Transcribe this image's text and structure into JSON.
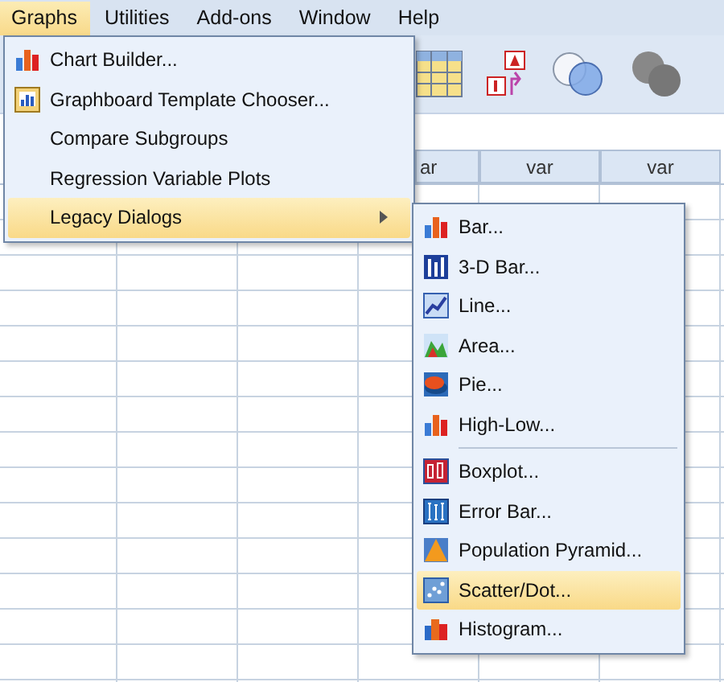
{
  "menubar": [
    {
      "label": "Graphs",
      "selected": true
    },
    {
      "label": "Utilities",
      "selected": false
    },
    {
      "label": "Add-ons",
      "selected": false
    },
    {
      "label": "Window",
      "selected": false
    },
    {
      "label": "Help",
      "selected": false
    }
  ],
  "grid": {
    "columns": [
      "ar",
      "var",
      "var"
    ]
  },
  "graphs_menu": [
    {
      "label": "Chart Builder...",
      "kind": "chart-builder",
      "selected": false,
      "submenu": false
    },
    {
      "label": "Graphboard Template Chooser...",
      "kind": "graphboard",
      "selected": false,
      "submenu": false
    },
    {
      "label": "Compare Subgroups",
      "kind": "plain",
      "selected": false,
      "submenu": false
    },
    {
      "label": "Regression Variable Plots",
      "kind": "plain",
      "selected": false,
      "submenu": false
    },
    {
      "label": "Legacy Dialogs",
      "kind": "plain",
      "selected": true,
      "submenu": true
    }
  ],
  "legacy_dialogs_menu": [
    {
      "label": "Bar...",
      "kind": "bar",
      "selected": false
    },
    {
      "label": "3-D Bar...",
      "kind": "bar3d",
      "selected": false
    },
    {
      "label": "Line...",
      "kind": "line",
      "selected": false
    },
    {
      "label": "Area...",
      "kind": "area",
      "selected": false
    },
    {
      "label": "Pie...",
      "kind": "pie",
      "selected": false
    },
    {
      "label": "High-Low...",
      "kind": "highlow",
      "selected": false
    },
    {
      "kind": "separator"
    },
    {
      "label": "Boxplot...",
      "kind": "boxplot",
      "selected": false
    },
    {
      "label": "Error Bar...",
      "kind": "errorbar",
      "selected": false
    },
    {
      "label": "Population Pyramid...",
      "kind": "pyramid",
      "selected": false
    },
    {
      "label": "Scatter/Dot...",
      "kind": "scatter",
      "selected": true
    },
    {
      "label": "Histogram...",
      "kind": "histogram",
      "selected": false
    }
  ]
}
